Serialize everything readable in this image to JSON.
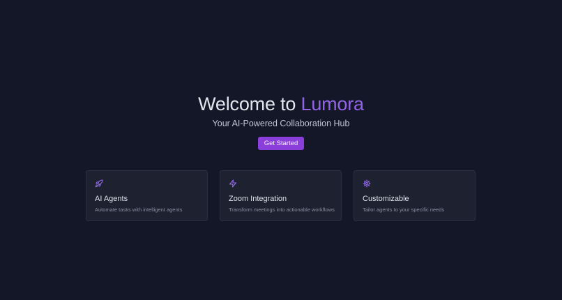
{
  "hero": {
    "title_prefix": "Welcome to ",
    "title_brand": "Lumora",
    "subtitle": "Your AI-Powered Collaboration Hub",
    "cta_label": "Get Started"
  },
  "features": [
    {
      "icon": "rocket-icon",
      "title": "AI Agents",
      "description": "Automate tasks with intelligent agents"
    },
    {
      "icon": "lightning-icon",
      "title": "Zoom Integration",
      "description": "Transform meetings into actionable workflows"
    },
    {
      "icon": "gear-icon",
      "title": "Customizable",
      "description": "Tailor agents to your specific needs"
    }
  ],
  "colors": {
    "background": "#131728",
    "brand": "#9464e6",
    "button": "#8a3fdb",
    "card": "#1d2130",
    "icon": "#9b6ff0"
  }
}
